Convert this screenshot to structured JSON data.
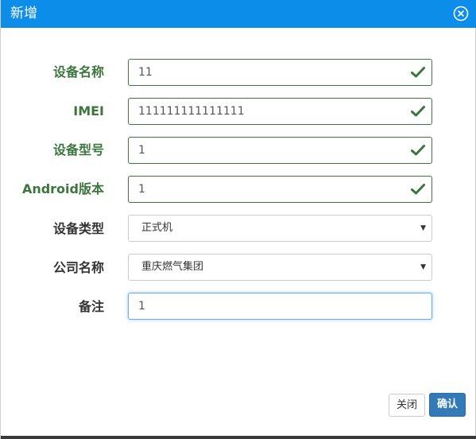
{
  "dialog": {
    "title": "新增",
    "close_icon": "close-circle-icon"
  },
  "form": {
    "fields": [
      {
        "label": "设备名称",
        "value": "11",
        "state": "success"
      },
      {
        "label": "IMEI",
        "value": "111111111111111",
        "state": "success"
      },
      {
        "label": "设备型号",
        "value": "1",
        "state": "success"
      },
      {
        "label": "Android版本",
        "value": "1",
        "state": "success"
      },
      {
        "label": "设备类型",
        "value": "正式机",
        "type": "select"
      },
      {
        "label": "公司名称",
        "value": "重庆燃气集团",
        "type": "select"
      },
      {
        "label": "备注",
        "value": "1",
        "state": "focused"
      }
    ]
  },
  "footer": {
    "close_label": "关闭",
    "confirm_label": "确认"
  },
  "colors": {
    "titlebar": "#0b8de9",
    "success": "#3c763d",
    "primary": "#337ab7",
    "focus": "#66afe9"
  }
}
